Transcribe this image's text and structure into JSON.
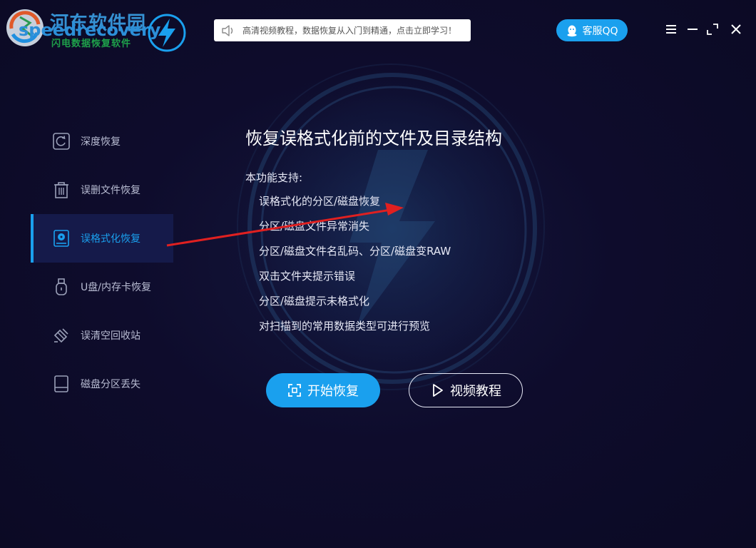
{
  "brand": {
    "watermark_cn": "河东软件园",
    "name_en": "speedrecovery",
    "subtitle": "闪电数据恢复软件"
  },
  "notice": {
    "text": "高清视频教程，数据恢复从入门到精通，点击立即学习！",
    "icon": "speaker-icon"
  },
  "header": {
    "qq_label": "客服QQ"
  },
  "window_controls": [
    "menu-icon",
    "minimize-icon",
    "maximize-icon",
    "close-icon"
  ],
  "sidebar": {
    "items": [
      {
        "label": "深度恢复",
        "icon": "deep-recovery-icon",
        "active": false
      },
      {
        "label": "误删文件恢复",
        "icon": "trash-icon",
        "active": false
      },
      {
        "label": "误格式化恢复",
        "icon": "format-disk-icon",
        "active": true
      },
      {
        "label": "U盘/内存卡恢复",
        "icon": "usb-icon",
        "active": false
      },
      {
        "label": "误清空回收站",
        "icon": "recycle-clear-icon",
        "active": false
      },
      {
        "label": "磁盘分区丢失",
        "icon": "partition-icon",
        "active": false
      }
    ]
  },
  "main": {
    "headline": "恢复误格式化前的文件及目录结构",
    "support_label": "本功能支持:",
    "features": [
      "误格式化的分区/磁盘恢复",
      "分区/磁盘文件异常消失",
      "分区/磁盘文件名乱码、分区/磁盘变RAW",
      "双击文件夹提示错误",
      "分区/磁盘提示未格式化",
      "对扫描到的常用数据类型可进行预览"
    ],
    "start_label": "开始恢复",
    "video_label": "视频教程"
  },
  "colors": {
    "accent": "#1aa0ee",
    "background": "#0d0b2a",
    "annotation_arrow": "#e02020"
  }
}
